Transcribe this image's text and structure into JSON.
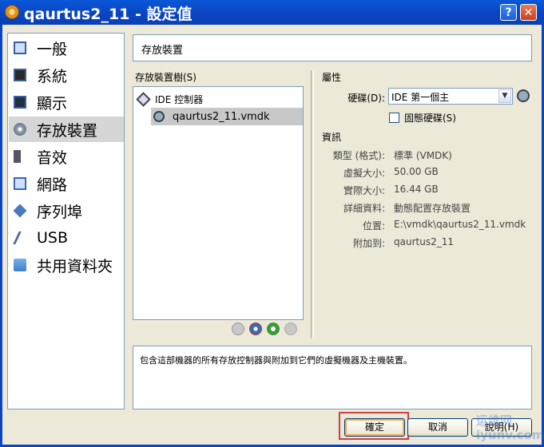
{
  "window": {
    "title": "qaurtus2_11 - 設定值",
    "help_glyph": "?",
    "close_glyph": "✕"
  },
  "sidebar": {
    "items": [
      {
        "label": "一般",
        "icon": "general-icon"
      },
      {
        "label": "系統",
        "icon": "system-icon"
      },
      {
        "label": "顯示",
        "icon": "display-icon"
      },
      {
        "label": "存放裝置",
        "icon": "storage-icon",
        "selected": true
      },
      {
        "label": "音效",
        "icon": "audio-icon"
      },
      {
        "label": "網路",
        "icon": "network-icon"
      },
      {
        "label": "序列埠",
        "icon": "serial-port-icon"
      },
      {
        "label": "USB",
        "icon": "usb-icon"
      },
      {
        "label": "共用資料夾",
        "icon": "shared-folder-icon"
      }
    ]
  },
  "main": {
    "page_title": "存放裝置",
    "tree": {
      "label": "存放裝置樹(S)",
      "controller": "IDE 控制器",
      "disk": "qaurtus2_11.vmdk"
    },
    "attributes": {
      "title": "屬性",
      "hard_disk_label": "硬碟(D):",
      "hard_disk_value": "IDE 第一個主",
      "solid_state_label": "固態硬碟(S)",
      "solid_state_checked": false
    },
    "info": {
      "title": "資訊",
      "rows": [
        {
          "key": "類型 (格式):",
          "value": "標準 (VMDK)"
        },
        {
          "key": "虛擬大小:",
          "value": "50.00 GB"
        },
        {
          "key": "實際大小:",
          "value": "16.44 GB"
        },
        {
          "key": "詳細資料:",
          "value": "動態配置存放裝置"
        },
        {
          "key": "位置:",
          "value": "E:\\vmdk\\qaurtus2_11.vmdk"
        },
        {
          "key": "附加到:",
          "value": "qaurtus2_11"
        }
      ]
    },
    "description": "包含這部機器的所有存放控制器與附加到它們的虛擬機器及主機裝置。"
  },
  "buttons": {
    "ok": "確定",
    "cancel": "取消",
    "help": "說明(H)"
  },
  "watermark": {
    "line1": "运维网",
    "line2": "iyunv.com"
  },
  "colors": {
    "titlebar": "#0a46c4",
    "selection": "#c8c8c8",
    "highlight_box": "#d04040"
  }
}
